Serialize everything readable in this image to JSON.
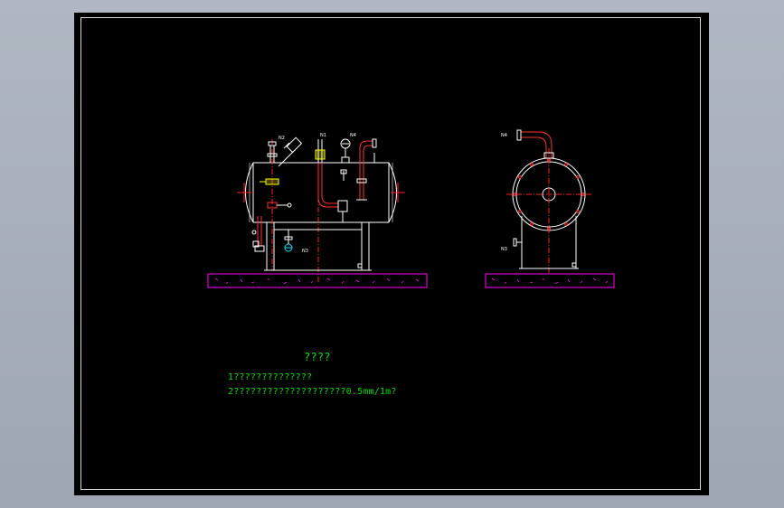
{
  "drawing": {
    "notes_title": "????",
    "notes": [
      "1??????????????",
      "2????????????????????0.5mm/1m?"
    ],
    "nozzle_tags": {
      "front_n2": "N2",
      "front_n1": "N1",
      "front_n4": "N4",
      "front_n3": "N3",
      "side_n4": "N4",
      "side_n3": "N3"
    }
  },
  "colors": {
    "vessel": "#ffffff",
    "centerline": "#ff2020",
    "pipe": "#ff3030",
    "valve": "#ffff00",
    "foundation": "#ff00ff",
    "gauge": "#00e5ff",
    "text": "#00e000"
  }
}
